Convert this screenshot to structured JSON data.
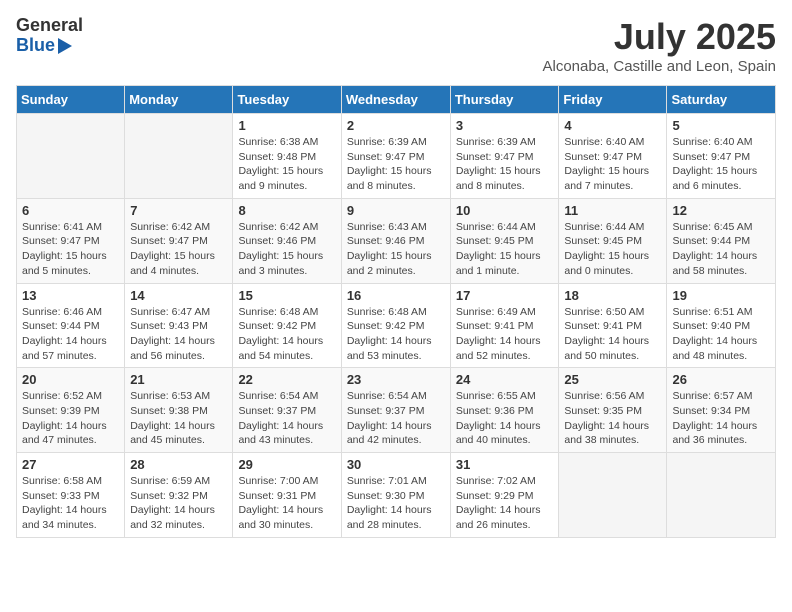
{
  "logo": {
    "general": "General",
    "blue": "Blue"
  },
  "title": "July 2025",
  "subtitle": "Alconaba, Castille and Leon, Spain",
  "days_of_week": [
    "Sunday",
    "Monday",
    "Tuesday",
    "Wednesday",
    "Thursday",
    "Friday",
    "Saturday"
  ],
  "weeks": [
    [
      {
        "day": "",
        "sunrise": "",
        "sunset": "",
        "daylight": ""
      },
      {
        "day": "",
        "sunrise": "",
        "sunset": "",
        "daylight": ""
      },
      {
        "day": "1",
        "sunrise": "Sunrise: 6:38 AM",
        "sunset": "Sunset: 9:48 PM",
        "daylight": "Daylight: 15 hours and 9 minutes."
      },
      {
        "day": "2",
        "sunrise": "Sunrise: 6:39 AM",
        "sunset": "Sunset: 9:47 PM",
        "daylight": "Daylight: 15 hours and 8 minutes."
      },
      {
        "day": "3",
        "sunrise": "Sunrise: 6:39 AM",
        "sunset": "Sunset: 9:47 PM",
        "daylight": "Daylight: 15 hours and 8 minutes."
      },
      {
        "day": "4",
        "sunrise": "Sunrise: 6:40 AM",
        "sunset": "Sunset: 9:47 PM",
        "daylight": "Daylight: 15 hours and 7 minutes."
      },
      {
        "day": "5",
        "sunrise": "Sunrise: 6:40 AM",
        "sunset": "Sunset: 9:47 PM",
        "daylight": "Daylight: 15 hours and 6 minutes."
      }
    ],
    [
      {
        "day": "6",
        "sunrise": "Sunrise: 6:41 AM",
        "sunset": "Sunset: 9:47 PM",
        "daylight": "Daylight: 15 hours and 5 minutes."
      },
      {
        "day": "7",
        "sunrise": "Sunrise: 6:42 AM",
        "sunset": "Sunset: 9:47 PM",
        "daylight": "Daylight: 15 hours and 4 minutes."
      },
      {
        "day": "8",
        "sunrise": "Sunrise: 6:42 AM",
        "sunset": "Sunset: 9:46 PM",
        "daylight": "Daylight: 15 hours and 3 minutes."
      },
      {
        "day": "9",
        "sunrise": "Sunrise: 6:43 AM",
        "sunset": "Sunset: 9:46 PM",
        "daylight": "Daylight: 15 hours and 2 minutes."
      },
      {
        "day": "10",
        "sunrise": "Sunrise: 6:44 AM",
        "sunset": "Sunset: 9:45 PM",
        "daylight": "Daylight: 15 hours and 1 minute."
      },
      {
        "day": "11",
        "sunrise": "Sunrise: 6:44 AM",
        "sunset": "Sunset: 9:45 PM",
        "daylight": "Daylight: 15 hours and 0 minutes."
      },
      {
        "day": "12",
        "sunrise": "Sunrise: 6:45 AM",
        "sunset": "Sunset: 9:44 PM",
        "daylight": "Daylight: 14 hours and 58 minutes."
      }
    ],
    [
      {
        "day": "13",
        "sunrise": "Sunrise: 6:46 AM",
        "sunset": "Sunset: 9:44 PM",
        "daylight": "Daylight: 14 hours and 57 minutes."
      },
      {
        "day": "14",
        "sunrise": "Sunrise: 6:47 AM",
        "sunset": "Sunset: 9:43 PM",
        "daylight": "Daylight: 14 hours and 56 minutes."
      },
      {
        "day": "15",
        "sunrise": "Sunrise: 6:48 AM",
        "sunset": "Sunset: 9:42 PM",
        "daylight": "Daylight: 14 hours and 54 minutes."
      },
      {
        "day": "16",
        "sunrise": "Sunrise: 6:48 AM",
        "sunset": "Sunset: 9:42 PM",
        "daylight": "Daylight: 14 hours and 53 minutes."
      },
      {
        "day": "17",
        "sunrise": "Sunrise: 6:49 AM",
        "sunset": "Sunset: 9:41 PM",
        "daylight": "Daylight: 14 hours and 52 minutes."
      },
      {
        "day": "18",
        "sunrise": "Sunrise: 6:50 AM",
        "sunset": "Sunset: 9:41 PM",
        "daylight": "Daylight: 14 hours and 50 minutes."
      },
      {
        "day": "19",
        "sunrise": "Sunrise: 6:51 AM",
        "sunset": "Sunset: 9:40 PM",
        "daylight": "Daylight: 14 hours and 48 minutes."
      }
    ],
    [
      {
        "day": "20",
        "sunrise": "Sunrise: 6:52 AM",
        "sunset": "Sunset: 9:39 PM",
        "daylight": "Daylight: 14 hours and 47 minutes."
      },
      {
        "day": "21",
        "sunrise": "Sunrise: 6:53 AM",
        "sunset": "Sunset: 9:38 PM",
        "daylight": "Daylight: 14 hours and 45 minutes."
      },
      {
        "day": "22",
        "sunrise": "Sunrise: 6:54 AM",
        "sunset": "Sunset: 9:37 PM",
        "daylight": "Daylight: 14 hours and 43 minutes."
      },
      {
        "day": "23",
        "sunrise": "Sunrise: 6:54 AM",
        "sunset": "Sunset: 9:37 PM",
        "daylight": "Daylight: 14 hours and 42 minutes."
      },
      {
        "day": "24",
        "sunrise": "Sunrise: 6:55 AM",
        "sunset": "Sunset: 9:36 PM",
        "daylight": "Daylight: 14 hours and 40 minutes."
      },
      {
        "day": "25",
        "sunrise": "Sunrise: 6:56 AM",
        "sunset": "Sunset: 9:35 PM",
        "daylight": "Daylight: 14 hours and 38 minutes."
      },
      {
        "day": "26",
        "sunrise": "Sunrise: 6:57 AM",
        "sunset": "Sunset: 9:34 PM",
        "daylight": "Daylight: 14 hours and 36 minutes."
      }
    ],
    [
      {
        "day": "27",
        "sunrise": "Sunrise: 6:58 AM",
        "sunset": "Sunset: 9:33 PM",
        "daylight": "Daylight: 14 hours and 34 minutes."
      },
      {
        "day": "28",
        "sunrise": "Sunrise: 6:59 AM",
        "sunset": "Sunset: 9:32 PM",
        "daylight": "Daylight: 14 hours and 32 minutes."
      },
      {
        "day": "29",
        "sunrise": "Sunrise: 7:00 AM",
        "sunset": "Sunset: 9:31 PM",
        "daylight": "Daylight: 14 hours and 30 minutes."
      },
      {
        "day": "30",
        "sunrise": "Sunrise: 7:01 AM",
        "sunset": "Sunset: 9:30 PM",
        "daylight": "Daylight: 14 hours and 28 minutes."
      },
      {
        "day": "31",
        "sunrise": "Sunrise: 7:02 AM",
        "sunset": "Sunset: 9:29 PM",
        "daylight": "Daylight: 14 hours and 26 minutes."
      },
      {
        "day": "",
        "sunrise": "",
        "sunset": "",
        "daylight": ""
      },
      {
        "day": "",
        "sunrise": "",
        "sunset": "",
        "daylight": ""
      }
    ]
  ]
}
